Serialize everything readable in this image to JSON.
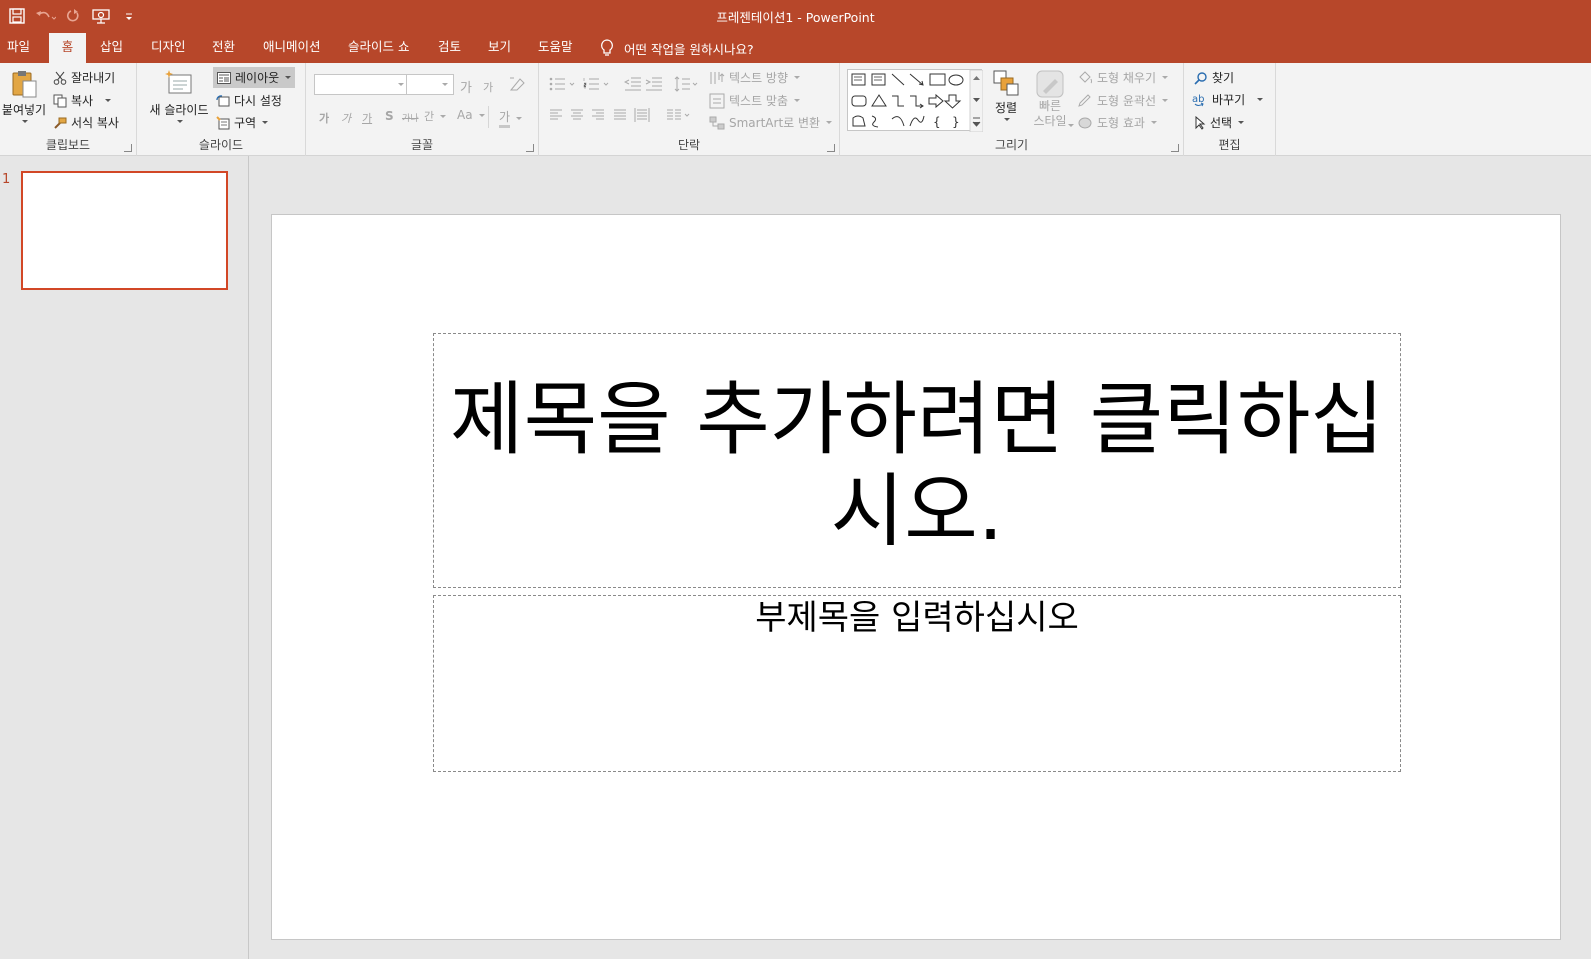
{
  "app": {
    "title": "프레젠테이션1",
    "separator": " - ",
    "app_name": "PowerPoint",
    "accent_color": "#b7472a"
  },
  "quick_access": {
    "icons": [
      "save-icon",
      "undo-icon",
      "redo-icon",
      "present-from-start-icon",
      "customize-qat-icon"
    ]
  },
  "tabs": [
    {
      "label": "파일"
    },
    {
      "label": "홈"
    },
    {
      "label": "삽입"
    },
    {
      "label": "디자인"
    },
    {
      "label": "전환"
    },
    {
      "label": "애니메이션"
    },
    {
      "label": "슬라이드 쇼"
    },
    {
      "label": "검토"
    },
    {
      "label": "보기"
    },
    {
      "label": "도움말"
    }
  ],
  "tell_me": "어떤 작업을 원하시나요?",
  "ribbon": {
    "clipboard": {
      "label": "클립보드",
      "paste": "붙여넣기",
      "cut": "잘라내기",
      "copy": "복사",
      "format_painter": "서식 복사"
    },
    "slides": {
      "label": "슬라이드",
      "new_slide": "새 슬라이드",
      "layout": "레이아웃",
      "reset": "다시 설정",
      "section": "구역"
    },
    "font": {
      "label": "글꼴",
      "grow": "가",
      "shrink": "가",
      "bold": "가",
      "italic": "가",
      "underline": "가",
      "shadow": "S",
      "strike": "가나",
      "spacing": "간",
      "case": "Aa",
      "color": "가"
    },
    "paragraph": {
      "label": "단락",
      "text_direction": "텍스트 방향",
      "align_text": "텍스트 맞춤",
      "smartart": "SmartArt로 변환"
    },
    "drawing": {
      "label": "그리기",
      "arrange": "정렬",
      "quick_styles": "빠른\n스타일",
      "quick_styles_line1": "빠른",
      "quick_styles_line2": "스타일",
      "fill": "도형 채우기",
      "outline": "도형 윤곽선",
      "effects": "도형 효과"
    },
    "editing": {
      "label": "편집",
      "find": "찾기",
      "replace": "바꾸기",
      "select": "선택"
    }
  },
  "slide_panel": {
    "slide_number": "1"
  },
  "slide": {
    "title_placeholder": "제목을 추가하려면 클릭하십시오.",
    "subtitle_placeholder": "부제목을 입력하십시오"
  }
}
